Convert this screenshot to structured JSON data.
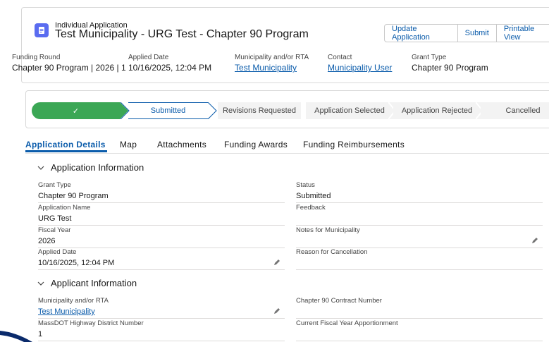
{
  "record": {
    "type_label": "Individual Application",
    "title": "Test Municipality - URG Test - Chapter 90 Program"
  },
  "actions": [
    "Update Application",
    "Submit",
    "Printable View"
  ],
  "highlights": [
    {
      "label": "Funding Round",
      "value": "Chapter 90 Program | 2026 | 1",
      "link": false
    },
    {
      "label": "Applied Date",
      "value": "10/16/2025, 12:04 PM",
      "link": false
    },
    {
      "label": "Municipality and/or RTA",
      "value": "Test Municipality",
      "link": true
    },
    {
      "label": "Contact",
      "value": "Municipality User",
      "link": true
    },
    {
      "label": "Grant Type",
      "value": "Chapter 90 Program",
      "link": false
    }
  ],
  "path": {
    "stages": [
      "✓",
      "Submitted",
      "Revisions Requested",
      "Application Selected",
      "Application Rejected",
      "Cancelled"
    ],
    "complete_color": "#3ba755",
    "current_stage": "Submitted"
  },
  "tabs": [
    "Application Details",
    "Map",
    "Attachments",
    "Funding Awards",
    "Funding Reimbursements"
  ],
  "sections": {
    "application_info": {
      "title": "Application Information",
      "left": [
        {
          "label": "Grant Type",
          "value": "Chapter 90 Program"
        },
        {
          "label": "Application Name",
          "value": "URG Test"
        },
        {
          "label": "Fiscal Year",
          "value": "2026"
        },
        {
          "label": "Applied Date",
          "value": "10/16/2025, 12:04 PM"
        }
      ],
      "right": [
        {
          "label": "Status",
          "value": "Submitted"
        },
        {
          "label": "Feedback",
          "value": ""
        },
        {
          "label": "Notes for Municipality",
          "value": ""
        },
        {
          "label": "Reason for Cancellation",
          "value": ""
        }
      ]
    },
    "applicant_info": {
      "title": "Applicant Information",
      "left": [
        {
          "label": "Municipality and/or RTA",
          "value": "Test Municipality"
        },
        {
          "label": "MassDOT Highway District Number",
          "value": "1"
        }
      ],
      "right": [
        {
          "label": "Chapter 90 Contract Number",
          "value": ""
        },
        {
          "label": "Current Fiscal Year Apportionment",
          "value": ""
        }
      ]
    }
  },
  "colors": {
    "brand": "#0b5cab",
    "icon_bg": "#5a6cf0",
    "accent_dark": "#0a2a6b"
  }
}
